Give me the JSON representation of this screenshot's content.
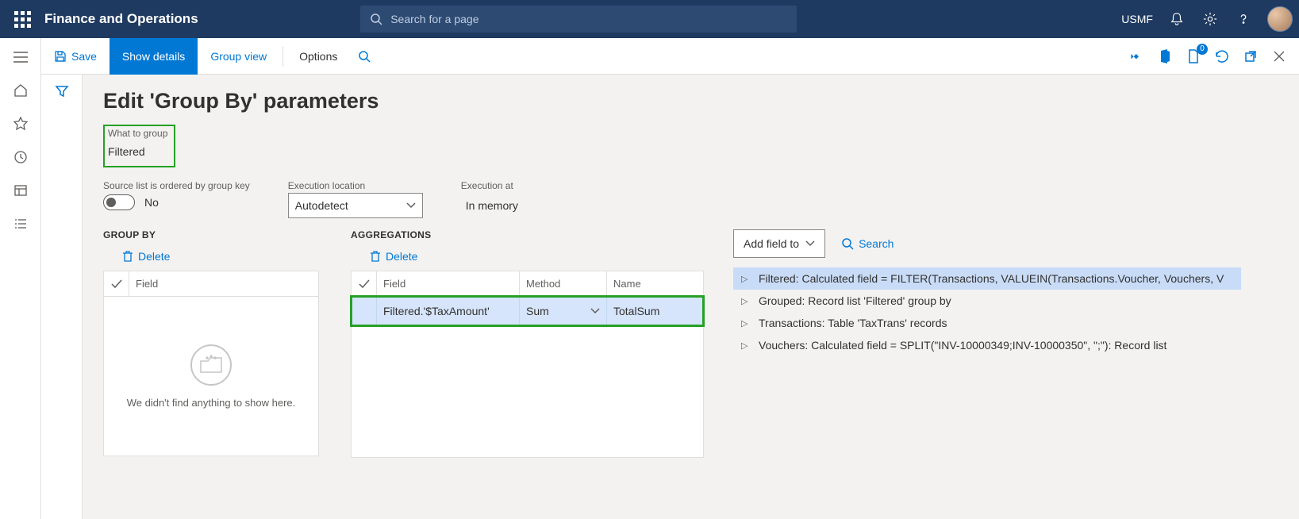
{
  "topbar": {
    "brand": "Finance and Operations",
    "search_placeholder": "Search for a page",
    "company": "USMF"
  },
  "cmdbar": {
    "save": "Save",
    "show_details": "Show details",
    "group_view": "Group view",
    "options": "Options",
    "badge": "0"
  },
  "page": {
    "title": "Edit 'Group By' parameters",
    "what_to_group_label": "What to group",
    "what_to_group_value": "Filtered",
    "source_ordered_label": "Source list is ordered by group key",
    "source_ordered_value": "No",
    "exec_location_label": "Execution location",
    "exec_location_value": "Autodetect",
    "exec_at_label": "Execution at",
    "exec_at_value": "In memory"
  },
  "groupby": {
    "heading": "GROUP BY",
    "delete": "Delete",
    "field_col": "Field",
    "empty_msg": "We didn't find anything to show here."
  },
  "agg": {
    "heading": "AGGREGATIONS",
    "delete": "Delete",
    "cols": {
      "field": "Field",
      "method": "Method",
      "name": "Name"
    },
    "row": {
      "field": "Filtered.'$TaxAmount'",
      "method": "Sum",
      "name": "TotalSum"
    }
  },
  "rightpane": {
    "add_field": "Add field to",
    "search": "Search",
    "tree": [
      "Filtered: Calculated field = FILTER(Transactions, VALUEIN(Transactions.Voucher, Vouchers, V",
      "Grouped: Record list 'Filtered' group by",
      "Transactions: Table 'TaxTrans' records",
      "Vouchers: Calculated field = SPLIT(\"INV-10000349;INV-10000350\", \";\"): Record list"
    ]
  },
  "chart_data": null
}
